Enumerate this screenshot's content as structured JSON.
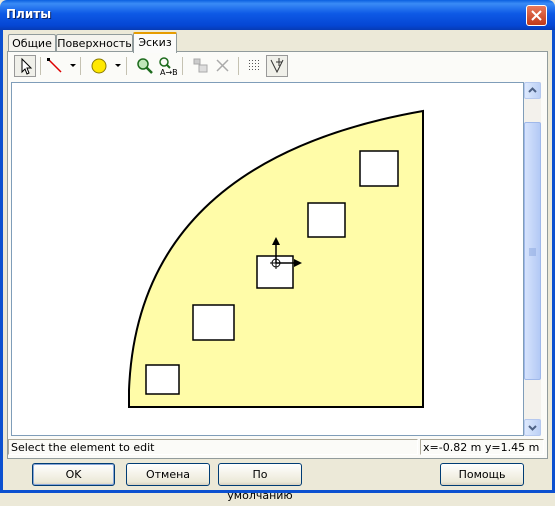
{
  "window": {
    "title": "Плиты"
  },
  "tabs": [
    {
      "label": "Общие"
    },
    {
      "label": "Поверхность"
    },
    {
      "label": "Эскиз",
      "active": true
    }
  ],
  "toolbar": {
    "tools": [
      {
        "icon": "select-arrow-icon"
      },
      {
        "icon": "draw-line-icon"
      },
      {
        "icon": "draw-circle-icon"
      },
      {
        "icon": "zoom-icon"
      },
      {
        "icon": "text-label-icon"
      },
      {
        "icon": "copy-element-icon"
      },
      {
        "icon": "delete-icon"
      },
      {
        "icon": "grid-icon"
      },
      {
        "icon": "snap-icon"
      }
    ]
  },
  "sketch": {
    "slab_fill": "#fffca8",
    "outline": "#000000"
  },
  "status": {
    "message": "Select the element to edit",
    "coords": "x=-0.82 m  y=1.45 m"
  },
  "buttons": {
    "ok": "OK",
    "cancel": "Отмена",
    "default": "По умолчанию",
    "help": "Помощь"
  }
}
